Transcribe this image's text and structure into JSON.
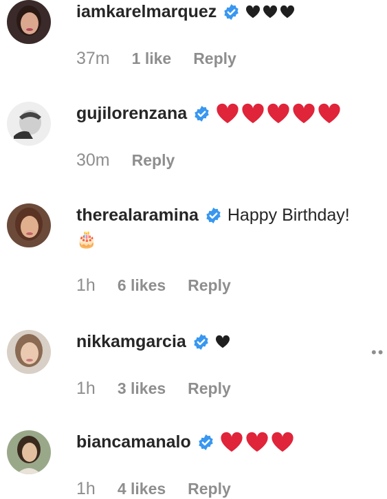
{
  "comments": [
    {
      "username": "iamkarelmarquez",
      "verified": true,
      "hearts": {
        "count": 3,
        "color": "#1f1f1f",
        "style": "black"
      },
      "text": "",
      "time": "37m",
      "likes": "1 like",
      "reply": "Reply",
      "avatar_colors": {
        "bg": "#3a2a2a",
        "face": "#d9a88f",
        "hair": "#2a1a15",
        "lips": "#b3485a"
      }
    },
    {
      "username": "gujilorenzana",
      "verified": true,
      "hearts": {
        "count": 5,
        "color": "#e0243a",
        "style": "red"
      },
      "text": "",
      "time": "30m",
      "likes": "",
      "reply": "Reply",
      "avatar_colors": {
        "bg": "#eeeeee",
        "face": "#cfcfcf",
        "hair": "#444444",
        "lips": "#777777"
      }
    },
    {
      "username": "therealaramina",
      "verified": true,
      "hearts": {
        "count": 0,
        "color": "",
        "style": ""
      },
      "text": "Happy Birthday!",
      "emoji": "🎂",
      "time": "1h",
      "likes": "6 likes",
      "reply": "Reply",
      "avatar_colors": {
        "bg": "#6b4a3a",
        "face": "#e0b08e",
        "hair": "#5a3324",
        "lips": "#c0606a"
      }
    },
    {
      "username": "nikkamgarcia",
      "verified": true,
      "hearts": {
        "count": 1,
        "color": "#1f1f1f",
        "style": "black"
      },
      "text": "",
      "time": "1h",
      "likes": "3 likes",
      "reply": "Reply",
      "avatar_colors": {
        "bg": "#d8cfc6",
        "face": "#ebc9b0",
        "hair": "#8a6a52",
        "lips": "#c77a7a"
      }
    },
    {
      "username": "biancamanalo",
      "verified": true,
      "hearts": {
        "count": 3,
        "color": "#e0243a",
        "style": "red"
      },
      "text": "",
      "time": "1h",
      "likes": "4 likes",
      "reply": "Reply",
      "avatar_colors": {
        "bg": "#9aa88a",
        "face": "#e2c0a0",
        "hair": "#3a2a1e",
        "lips": "#bf6f6a"
      }
    }
  ],
  "more_label": "••",
  "colors": {
    "verified_blue": "#3897f0",
    "meta_gray": "#8e8e8e",
    "username": "#262626"
  }
}
